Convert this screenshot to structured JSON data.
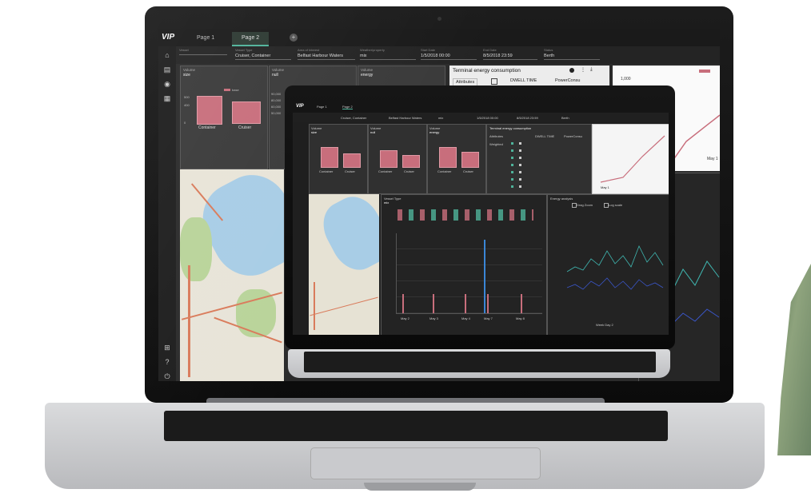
{
  "app": {
    "logo": "VIP",
    "tabs": [
      "Page 1",
      "Page 2"
    ],
    "add_tab": "+"
  },
  "filters": [
    {
      "label": "Vessel",
      "value": ""
    },
    {
      "label": "Vessel Type",
      "value": "Cruiser, Container"
    },
    {
      "label": "Area of Interest",
      "value": "Belfast Harbour Waters"
    },
    {
      "label": "Weather/property",
      "value": "mix"
    },
    {
      "label": "Start Date",
      "value": "1/5/2018 00:00"
    },
    {
      "label": "End Date",
      "value": "8/5/2018 23:59"
    },
    {
      "label": "Status",
      "value": "Berth"
    }
  ],
  "panels": {
    "volume1": {
      "title": "Volume",
      "subtitle": "size",
      "legend": "base",
      "categories": [
        "Container",
        "Cruiser"
      ],
      "yticks": [
        "500",
        "400",
        "0"
      ]
    },
    "volume2": {
      "title": "Volume",
      "subtitle": "null",
      "yticks": [
        "90,000",
        "80,000",
        "60,000",
        "50,000"
      ]
    },
    "volume3": {
      "title": "Volume",
      "subtitle": "energy"
    },
    "energy": {
      "title": "Terminal energy consumption",
      "col_attributes": "Attributes",
      "col_time": "DWELL TIME",
      "col_power": "PowerConsu"
    },
    "line": {
      "ytick": "1,000",
      "xlabel": "May 1"
    }
  },
  "small_screen": {
    "energy_title": "Terminal energy consumption",
    "energy_headers": [
      "Attributes",
      "DWELL TIME",
      "PowerConsu"
    ],
    "energy_row_label": "Weighted",
    "volume_titles": [
      "Volume",
      "Volume",
      "Volume"
    ],
    "volume_subs": [
      "size",
      "null",
      "energy"
    ],
    "categories": [
      "Container",
      "Cruiser"
    ],
    "bar_panel_title": "Vessel Type",
    "bar_panel_sub": "mix",
    "scatter_title": "Energy analysis",
    "scatter_options": [
      "Drag Zoom",
      "Log scale"
    ],
    "scatter_xlabel": "Week Day 2",
    "line_label": "May 1",
    "xlabels": [
      "May 2",
      "May 3",
      "May 4",
      "May 7",
      "May 8"
    ]
  },
  "colors": {
    "accent": "#4fb39a",
    "bar": "#c86e7c",
    "scatter1": "#3fb6b0",
    "scatter2": "#3a56c8"
  }
}
